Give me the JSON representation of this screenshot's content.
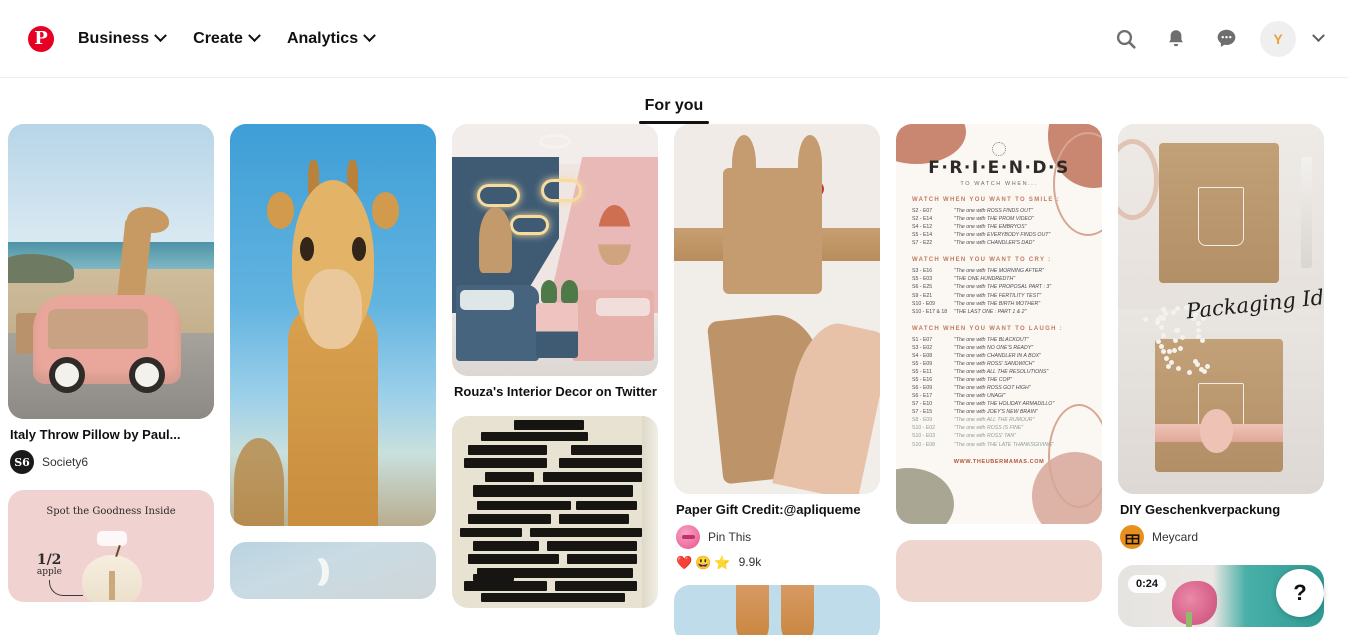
{
  "header": {
    "logo": "pinterest-logo",
    "nav_items": [
      {
        "label": "Business",
        "icon": "chevron-down-icon"
      },
      {
        "label": "Create",
        "icon": "chevron-down-icon"
      },
      {
        "label": "Analytics",
        "icon": "chevron-down-icon"
      }
    ],
    "actions": [
      {
        "name": "search-icon"
      },
      {
        "name": "notifications-bell-icon"
      },
      {
        "name": "messages-icon"
      }
    ],
    "avatar_initial": "Y",
    "account_chevron": "chevron-down-icon"
  },
  "tabs": [
    {
      "label": "For you",
      "active": true
    }
  ],
  "help": {
    "label": "?"
  },
  "feed": {
    "columns": [
      {
        "pins": [
          {
            "art": "giraffe-car",
            "title": "Italy Throw Pillow by Paul...",
            "author": "Society6",
            "avatar_text": "S6",
            "avatar_bg": "#1a1a1a",
            "avatar_fg": "#ffffff"
          },
          {
            "art": "apple-goodness",
            "overlay_title": "Spot the Goodness Inside",
            "overlay_fraction": "1/2",
            "overlay_unit": "apple"
          }
        ]
      },
      {
        "pins": [
          {
            "art": "giraffe-portrait"
          },
          {
            "art": "moon-sky"
          }
        ]
      },
      {
        "pins": [
          {
            "art": "kids-bedroom",
            "title": "Rouza's Interior Decor on Twitter"
          },
          {
            "art": "blackout-poetry"
          }
        ]
      },
      {
        "pins": [
          {
            "art": "paper-bunny-gift",
            "title": "Paper Gift Credit:@apliqueme",
            "author": "Pin This",
            "avatar_bg": "#e8548f",
            "reactions": [
              "❤️",
              "😃",
              "⭐"
            ],
            "reaction_count": "9.9k"
          },
          {
            "art": "skin-tone-block"
          }
        ]
      },
      {
        "pins": [
          {
            "art": "friends-list",
            "friends": {
              "logo": "F·R·I·E·N·D·S",
              "subtitle": "TO WATCH WHEN...",
              "url": "WWW.THEUBERMAMAS.COM",
              "sections": [
                {
                  "heading": "WATCH WHEN YOU WANT TO SMILE :",
                  "rows": [
                    {
                      "ep": "S2 - E07",
                      "text": "\"The one with ROSS FINDS OUT\""
                    },
                    {
                      "ep": "S2 - E14",
                      "text": "\"The one with THE PROM VIDEO\""
                    },
                    {
                      "ep": "S4 - E12",
                      "text": "\"The one with THE EMBRYOS\""
                    },
                    {
                      "ep": "S5 - E14",
                      "text": "\"The one with EVERYBODY FINDS OUT\""
                    },
                    {
                      "ep": "S7 - E22",
                      "text": "\"The one with CHANDLER'S DAD\""
                    }
                  ]
                },
                {
                  "heading": "WATCH WHEN YOU WANT TO CRY :",
                  "rows": [
                    {
                      "ep": "S3 - E16",
                      "text": "\"The one with THE MORNING AFTER\""
                    },
                    {
                      "ep": "S5 - E03",
                      "text": "\"THE ONE HUNDREDTH\""
                    },
                    {
                      "ep": "S6 - E25",
                      "text": "\"The one with THE PROPOSAL PART : 3\""
                    },
                    {
                      "ep": "S9 - E21",
                      "text": "\"The one with THE FERTILITY TEST\""
                    },
                    {
                      "ep": "S10 - E09",
                      "text": "\"The one with THE BIRTH MOTHER\""
                    },
                    {
                      "ep": "S10 - E17 & 18",
                      "text": "\"THE LAST ONE : PART 1 & 2\""
                    }
                  ]
                },
                {
                  "heading": "WATCH WHEN YOU WANT TO LAUGH :",
                  "rows": [
                    {
                      "ep": "S1 - E07",
                      "text": "\"The one with THE BLACKOUT\""
                    },
                    {
                      "ep": "S3 - E02",
                      "text": "\"The one with NO ONE'S READY\""
                    },
                    {
                      "ep": "S4 - E08",
                      "text": "\"The one with CHANDLER IN A BOX\""
                    },
                    {
                      "ep": "S5 - E09",
                      "text": "\"The one with ROSS' SANDWICH\""
                    },
                    {
                      "ep": "S5 - E11",
                      "text": "\"The one with ALL THE RESOLUTIONS\""
                    },
                    {
                      "ep": "S5 - E16",
                      "text": "\"The one with THE COP\""
                    },
                    {
                      "ep": "S6 - E09",
                      "text": "\"The one with ROSS GOT HIGH\""
                    },
                    {
                      "ep": "S6 - E17",
                      "text": "\"The one with UNAGI\""
                    },
                    {
                      "ep": "S7 - E10",
                      "text": "\"The one with THE HOLIDAY ARMADILLO\""
                    },
                    {
                      "ep": "S7 - E15",
                      "text": "\"The one with JOEY'S NEW BRAIN\""
                    },
                    {
                      "ep": "S8 - E09",
                      "text": "\"The one with ALL THE RUMOUR\""
                    },
                    {
                      "ep": "S10 - E02",
                      "text": "\"The one with ROSS IS FINE\""
                    },
                    {
                      "ep": "S10 - E03",
                      "text": "\"The one with ROSS' TAN\""
                    },
                    {
                      "ep": "S10 - E08",
                      "text": "\"The one with THE LATE THANKSGIVING\""
                    }
                  ]
                }
              ]
            }
          },
          {
            "art": "pink-block"
          }
        ]
      },
      {
        "pins": [
          {
            "art": "packaging-idea",
            "script_text": "Packaging Idea",
            "title": "DIY Geschenkverpackung",
            "author": "Meycard",
            "avatar_bg": "#e8901e",
            "avatar_icon": "gift-icon"
          },
          {
            "art": "video-flower",
            "duration": "0:24"
          }
        ]
      }
    ]
  }
}
